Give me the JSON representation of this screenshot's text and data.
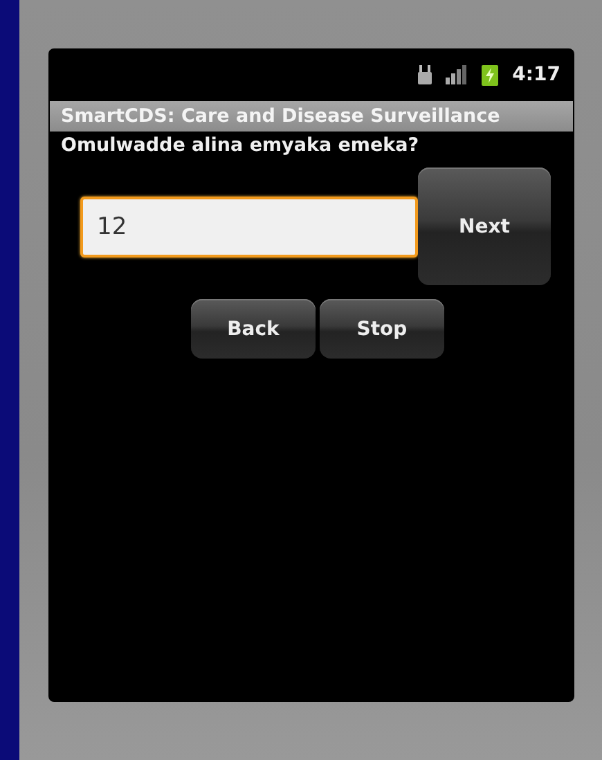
{
  "status_bar": {
    "time": "4:17"
  },
  "title_bar": {
    "title": "SmartCDS: Care and Disease Surveillance"
  },
  "question": {
    "text": "Omulwadde alina emyaka emeka?"
  },
  "answer": {
    "value": "12",
    "focused": true
  },
  "buttons": [
    {
      "label": "Next",
      "kind": "next"
    },
    {
      "label": "Back",
      "kind": "nav"
    },
    {
      "label": "Stop",
      "kind": "nav"
    }
  ]
}
